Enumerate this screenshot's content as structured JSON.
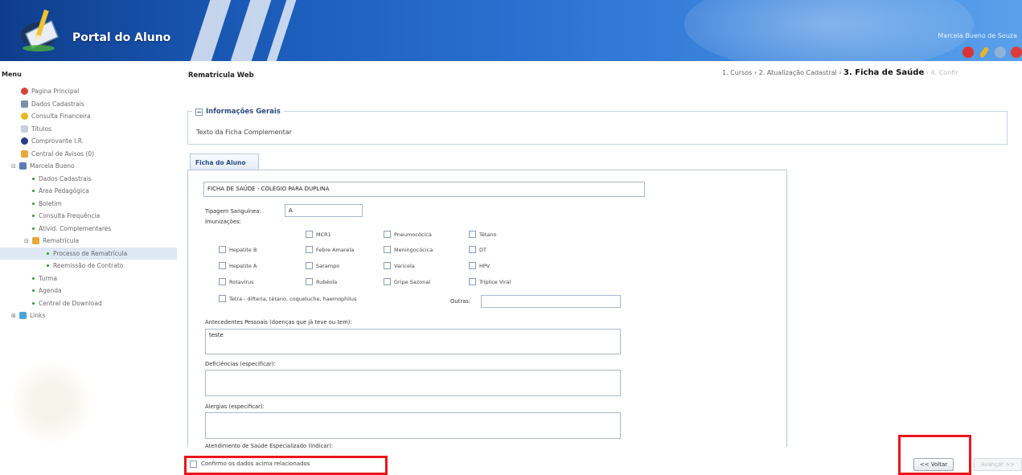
{
  "header": {
    "app_title": "Portal do Aluno",
    "user_name": "Marcela Bueno de Souza",
    "toolbar_icons": [
      "notifications-icon",
      "key-icon",
      "settings-icon",
      "logout-icon"
    ]
  },
  "sidebar": {
    "title": "Menu",
    "items": [
      {
        "label": "Pagina Principal",
        "icon": "home-icon"
      },
      {
        "label": "Dados Cadastrais",
        "icon": "table-icon"
      },
      {
        "label": "Consulta Financeira",
        "icon": "coin-icon"
      },
      {
        "label": "Títulos",
        "icon": "document-icon"
      },
      {
        "label": "Comprovante I.R.",
        "icon": "receipt-icon"
      },
      {
        "label": "Central de Avisos (0)",
        "icon": "folder-icon"
      },
      {
        "label": "Marcela Bueno",
        "icon": "user-icon"
      },
      {
        "label": "Dados Cadastrais"
      },
      {
        "label": "Área Pedagógica"
      },
      {
        "label": "Boletim"
      },
      {
        "label": "Consulta Frequência"
      },
      {
        "label": "Ativid. Complementares"
      },
      {
        "label": "Rematrícula",
        "icon": "folder-icon"
      },
      {
        "label": "Processo de Rematrícula"
      },
      {
        "label": "Reemissão de Contrato"
      },
      {
        "label": "Turma"
      },
      {
        "label": "Agenda"
      },
      {
        "label": "Central de Download"
      },
      {
        "label": "Links",
        "icon": "links-icon"
      }
    ]
  },
  "main": {
    "heading": "Rematricula Web",
    "steps": {
      "done": "1. Cursos › 2. Atualização Cadastral › ",
      "current": "3. Ficha de Saúde",
      "future": " › 4. Confir"
    },
    "info": {
      "legend": "Informações Gerais",
      "toggle": "−",
      "text": "Texto da Ficha Complementar"
    },
    "tab": "Ficha do Aluno",
    "form": {
      "title_value": "FICHA DE SAÚDE - COLÉGIO PARA DUPLINA",
      "blood_type_label": "Tipagem Sanguínea:",
      "blood_type_value": "A",
      "vaccines_label": "Imunizações:",
      "vaccines": [
        "MCR1",
        "Pneumocócica",
        "Tétano",
        "Hepatite B",
        "Febre Amarela",
        "Meningocócica",
        "DT",
        "Hepatite A",
        "Sarampo",
        "Varicela",
        "HPV",
        "Rotavírus",
        "Rubéola",
        "Gripe Sazonal",
        "Tríplice Viral",
        "Tetra - difteria, tétano, coqueluche, haemophilus"
      ],
      "others_label": "Outras:",
      "others_value": "",
      "history_label": "Antecedentes Pessoais (doenças que já teve ou tem):",
      "history_value": "teste",
      "disability_label": "Deficiências (especificar):",
      "disability_value": "",
      "allergies_label": "Alergias (especificar):",
      "allergies_value": "",
      "specialized_label": "Atendimento de Saúde Especializado (Indicar):"
    },
    "confirm_label": "Confirmo os dados acima relacionados",
    "back_button": "<< Voltar",
    "next_button": "Avançar >>"
  }
}
